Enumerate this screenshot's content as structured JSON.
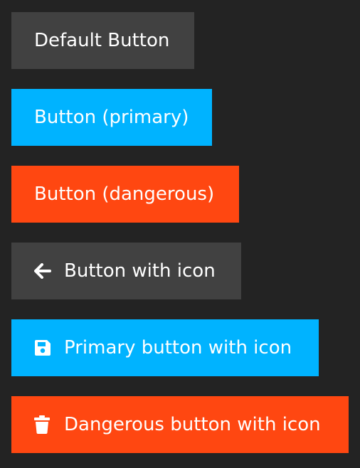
{
  "buttons": [
    {
      "label": "Default Button",
      "variant": "default"
    },
    {
      "label": "Button (primary)",
      "variant": "primary"
    },
    {
      "label": "Button (dangerous)",
      "variant": "dangerous"
    },
    {
      "label": "Button with icon",
      "variant": "default",
      "icon": "arrow-left-icon"
    },
    {
      "label": "Primary button with icon",
      "variant": "primary",
      "icon": "save-icon"
    },
    {
      "label": "Dangerous button with icon",
      "variant": "dangerous",
      "icon": "trash-icon"
    }
  ],
  "colors": {
    "background": "#232323",
    "default": "#414141",
    "primary": "#00b3ff",
    "dangerous": "#ff4711",
    "text": "#ffffff"
  }
}
